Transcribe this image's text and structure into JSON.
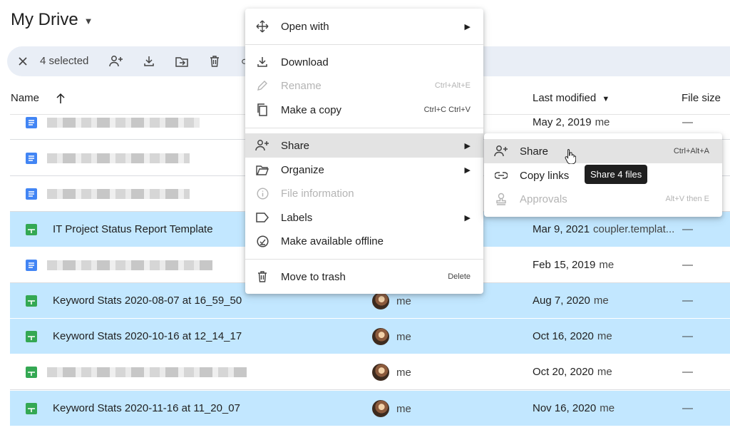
{
  "header": {
    "title": "My Drive"
  },
  "selection": {
    "count_label": "4 selected"
  },
  "columns": {
    "name": "Name",
    "last_modified": "Last modified",
    "file_size": "File size"
  },
  "rows": [
    {
      "type": "doc",
      "name": "",
      "owner": "",
      "modified": "May 2, 2019",
      "modified_by": "me",
      "size": "—",
      "selected": false
    },
    {
      "type": "doc",
      "name": "",
      "owner": "",
      "modified": "",
      "modified_by": "",
      "size": "",
      "selected": false
    },
    {
      "type": "doc",
      "name": "",
      "owner": "",
      "modified": "",
      "modified_by": "",
      "size": "",
      "selected": false
    },
    {
      "type": "sheet",
      "name": "IT Project Status Report Template",
      "owner": "",
      "modified": "Mar 9, 2021",
      "modified_by": "coupler.templat...",
      "size": "—",
      "selected": true
    },
    {
      "type": "doc",
      "name": "",
      "owner": "",
      "modified": "Feb 15, 2019",
      "modified_by": "me",
      "size": "—",
      "selected": false
    },
    {
      "type": "sheet",
      "name": "Keyword Stats 2020-08-07 at 16_59_50",
      "owner": "me",
      "modified": "Aug 7, 2020",
      "modified_by": "me",
      "size": "—",
      "selected": true
    },
    {
      "type": "sheet",
      "name": "Keyword Stats 2020-10-16 at 12_14_17",
      "owner": "me",
      "modified": "Oct 16, 2020",
      "modified_by": "me",
      "size": "—",
      "selected": true
    },
    {
      "type": "sheet",
      "name": "",
      "owner": "me",
      "modified": "Oct 20, 2020",
      "modified_by": "me",
      "size": "—",
      "selected": false
    },
    {
      "type": "sheet",
      "name": "Keyword Stats 2020-11-16 at 11_20_07",
      "owner": "me",
      "modified": "Nov 16, 2020",
      "modified_by": "me",
      "size": "—",
      "selected": true
    }
  ],
  "context_menu": {
    "open_with": "Open with",
    "download": "Download",
    "rename": "Rename",
    "rename_shortcut": "Ctrl+Alt+E",
    "make_copy": "Make a copy",
    "make_copy_shortcut": "Ctrl+C Ctrl+V",
    "share": "Share",
    "organize": "Organize",
    "file_information": "File information",
    "labels": "Labels",
    "make_offline": "Make available offline",
    "move_to_trash": "Move to trash",
    "move_to_trash_shortcut": "Delete"
  },
  "share_submenu": {
    "share": "Share",
    "share_shortcut": "Ctrl+Alt+A",
    "copy_links": "Copy links",
    "approvals": "Approvals",
    "approvals_shortcut": "Alt+V then E"
  },
  "tooltip": {
    "text": "Share 4 files"
  }
}
